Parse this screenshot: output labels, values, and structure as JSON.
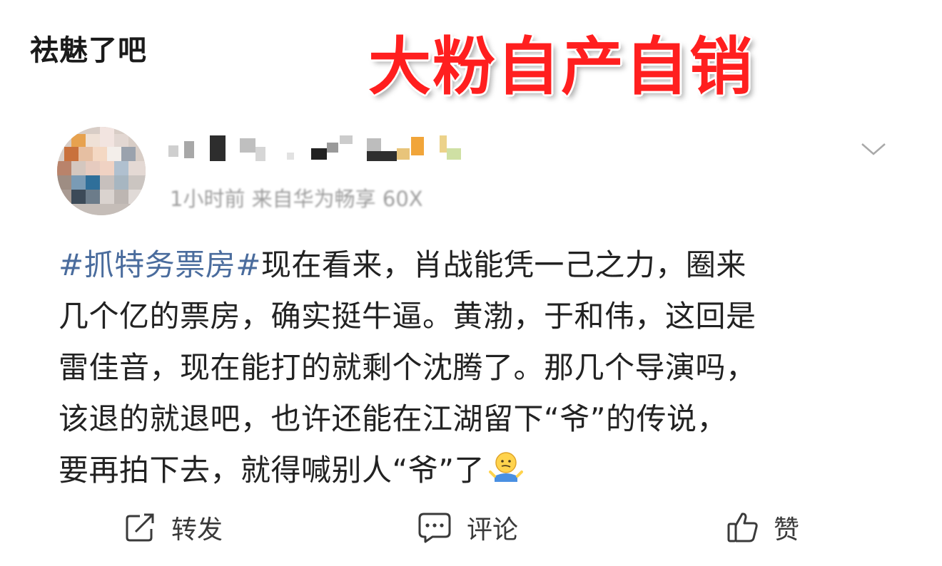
{
  "caption": "祛魅了吧",
  "headline": "大粉自产自销",
  "headline_color": "#ff1f1f",
  "post": {
    "author": {
      "avatar_icon": "avatar-pixelated",
      "username_obscured": true,
      "meta_text": "1小时前 来自华为畅享 60X"
    },
    "menu_icon": "chevron-down-icon",
    "hashtag": "#抓特务票房#",
    "lines": [
      "现在看来，肖战能凭一己之力，圈来",
      "几个亿的票房，确实挺牛逼。黄渤，于和伟，这回是",
      "雷佳音，现在能打的就剩个沈腾了。那几个导演吗，",
      "该退的就退吧，也许还能在江湖留下“爷”的传说，",
      "要再拍下去，就得喊别人“爷”了"
    ],
    "emoji": "shrug-emoji",
    "hashtag_color": "#4a6c9d"
  },
  "actions": {
    "repost": {
      "label": "转发",
      "icon": "repost-icon"
    },
    "comment": {
      "label": "评论",
      "icon": "comment-icon"
    },
    "like": {
      "label": "赞",
      "icon": "thumbs-up-icon"
    }
  }
}
